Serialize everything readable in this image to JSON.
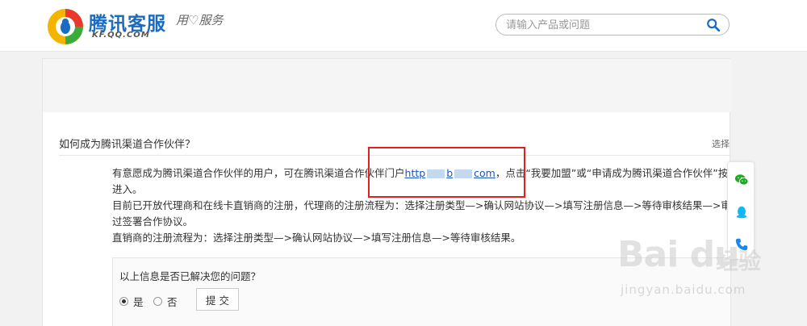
{
  "header": {
    "logo_title": "腾讯客服",
    "logo_sub": "KF.QQ.COM",
    "slogan": "用♡服务",
    "search_placeholder": "请输入产品或问题"
  },
  "question": {
    "title": "如何成为腾讯渠道合作伙伴？",
    "right_text": "选择"
  },
  "answer": {
    "line1_a": "有意愿成为腾讯渠道合作伙伴的用户，可在腾讯渠道合作伙伴门户",
    "link_a": "http",
    "link_b": "b",
    "link_c": "com",
    "line1_b": "，点击“我要加盟”或“申请成为腾讯渠道合作伙伴”按钮",
    "line2": "进入。",
    "line3": "目前已开放代理商和在线卡直销商的注册，代理商的注册流程为：选择注册类型—>确认网站协议—>填写注册信息—>等待审核结果—>审核通",
    "line4": "过签署合作协议。",
    "line5": "直销商的注册流程为：选择注册类型—>确认网站协议—>填写注册信息—>等待审核结果。"
  },
  "feedback": {
    "question": "以上信息是否已解决您的问题？",
    "yes": "是",
    "no": "否",
    "submit": "提 交"
  },
  "watermark": {
    "logo": "Bai du",
    "cn": "经验",
    "url": "jingyan.baidu.com"
  },
  "colors": {
    "brand": "#1a6bc1",
    "link": "#1a55c4",
    "highlight": "#e02020",
    "wechat": "#1aad19",
    "qq": "#12b7f5",
    "phone": "#1a88e6"
  },
  "icons": {
    "search": "search-icon",
    "wechat": "wechat-icon",
    "qq": "qq-penguin-icon",
    "phone": "phone-icon"
  }
}
